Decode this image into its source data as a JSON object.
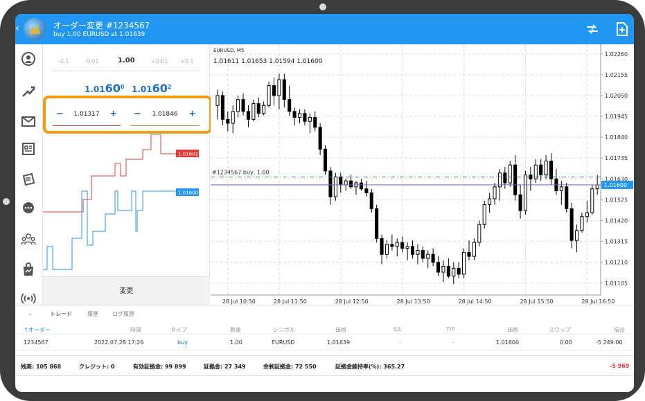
{
  "header": {
    "title": "オーダー変更 #1234567",
    "subtitle": "buy 1.00 EURUSD at 1.01639"
  },
  "volume": {
    "options": [
      "-0.1",
      "-0.01",
      "1.00",
      "+0.01",
      "+0.1"
    ],
    "selected": "1.00"
  },
  "quotes": {
    "bid": {
      "prefix": "1.01",
      "big": "60",
      "sup": "0"
    },
    "ask": {
      "prefix": "1.01",
      "big": "60",
      "sup": "2"
    }
  },
  "stop_loss": {
    "minus": "−",
    "plus": "+",
    "value": "1.01317"
  },
  "take_profit": {
    "minus": "−",
    "plus": "+",
    "value": "1.01846"
  },
  "depth_labels": {
    "ask": "1.01602",
    "bid": "1.01600"
  },
  "modify_label": "変更",
  "chart": {
    "symbol": "EURUSD, M5",
    "ohlc": "1.01611 1.01653 1.01594 1.01600",
    "order_label": "#1234567    buy, 1.00",
    "current_price": "1.01600",
    "y_labels": [
      "1.02260",
      "1.02155",
      "1.02050",
      "1.01945",
      "1.01840",
      "1.01735",
      "1.01630",
      "1.01525",
      "1.01420",
      "1.01315",
      "1.01210",
      "1.01105"
    ],
    "x_labels": [
      "28 Jul 10:50",
      "28 Jul 11:50",
      "28 Jul 12:50",
      "28 Jul 13:50",
      "28 Jul 14:50",
      "28 Jul 15:50",
      "28 Jul 16:50"
    ]
  },
  "chart_data": {
    "type": "candlestick",
    "symbol": "EURUSD",
    "timeframe": "M5",
    "ylim": [
      1.0105,
      1.0231
    ],
    "open_order_price": 1.01639,
    "current_price": 1.016,
    "candles": [
      [
        1.02,
        1.0208,
        1.0193,
        1.0205
      ],
      [
        1.0205,
        1.0207,
        1.019,
        1.0193
      ],
      [
        1.0193,
        1.0197,
        1.0187,
        1.0191
      ],
      [
        1.0191,
        1.02,
        1.0186,
        1.0197
      ],
      [
        1.0197,
        1.0205,
        1.0194,
        1.0203
      ],
      [
        1.0203,
        1.0206,
        1.0195,
        1.0197
      ],
      [
        1.0197,
        1.02,
        1.0189,
        1.0193
      ],
      [
        1.0193,
        1.0203,
        1.0192,
        1.0201
      ],
      [
        1.0201,
        1.0204,
        1.0194,
        1.0196
      ],
      [
        1.0196,
        1.0202,
        1.0195,
        1.02
      ],
      [
        1.02,
        1.0212,
        1.0199,
        1.021
      ],
      [
        1.021,
        1.0214,
        1.02,
        1.0205
      ],
      [
        1.0205,
        1.0216,
        1.0198,
        1.0213
      ],
      [
        1.0213,
        1.0216,
        1.0199,
        1.0203
      ],
      [
        1.0203,
        1.021,
        1.0195,
        1.0197
      ],
      [
        1.0197,
        1.0199,
        1.019,
        1.0194
      ],
      [
        1.0194,
        1.0198,
        1.0191,
        1.0196
      ],
      [
        1.0196,
        1.0198,
        1.019,
        1.0192
      ],
      [
        1.0192,
        1.0196,
        1.0186,
        1.0194
      ],
      [
        1.0194,
        1.0197,
        1.0187,
        1.0189
      ],
      [
        1.0189,
        1.0191,
        1.0175,
        1.0178
      ],
      [
        1.0178,
        1.018,
        1.0165,
        1.0167
      ],
      [
        1.0167,
        1.0169,
        1.015,
        1.0154
      ],
      [
        1.0154,
        1.0166,
        1.0152,
        1.0164
      ],
      [
        1.0164,
        1.0166,
        1.0156,
        1.016
      ],
      [
        1.016,
        1.0163,
        1.0157,
        1.0162
      ],
      [
        1.0162,
        1.0165,
        1.0158,
        1.0159
      ],
      [
        1.0159,
        1.0162,
        1.0155,
        1.0161
      ],
      [
        1.0161,
        1.0163,
        1.0157,
        1.0158
      ],
      [
        1.0158,
        1.0162,
        1.0154,
        1.0156
      ],
      [
        1.0156,
        1.0158,
        1.0146,
        1.0148
      ],
      [
        1.0148,
        1.015,
        1.0131,
        1.0133
      ],
      [
        1.0133,
        1.0135,
        1.012,
        1.0125
      ],
      [
        1.0125,
        1.0132,
        1.0123,
        1.013
      ],
      [
        1.013,
        1.0135,
        1.0127,
        1.0129
      ],
      [
        1.0129,
        1.0133,
        1.0124,
        1.0131
      ],
      [
        1.0131,
        1.0134,
        1.0126,
        1.0128
      ],
      [
        1.0128,
        1.0131,
        1.0122,
        1.0129
      ],
      [
        1.0129,
        1.0132,
        1.0123,
        1.0125
      ],
      [
        1.0125,
        1.013,
        1.012,
        1.0127
      ],
      [
        1.0127,
        1.0129,
        1.0121,
        1.0123
      ],
      [
        1.0123,
        1.0127,
        1.0118,
        1.0125
      ],
      [
        1.0125,
        1.0128,
        1.0119,
        1.0121
      ],
      [
        1.0121,
        1.0124,
        1.0114,
        1.0116
      ],
      [
        1.0116,
        1.0122,
        1.0111,
        1.0119
      ],
      [
        1.0119,
        1.0123,
        1.0113,
        1.0114
      ],
      [
        1.0114,
        1.0121,
        1.011,
        1.0118
      ],
      [
        1.0118,
        1.0121,
        1.0113,
        1.0115
      ],
      [
        1.0115,
        1.0128,
        1.0113,
        1.0126
      ],
      [
        1.0126,
        1.0132,
        1.0122,
        1.0124
      ],
      [
        1.0124,
        1.0133,
        1.0122,
        1.0131
      ],
      [
        1.0131,
        1.0142,
        1.0129,
        1.014
      ],
      [
        1.014,
        1.0152,
        1.0138,
        1.015
      ],
      [
        1.015,
        1.0156,
        1.0146,
        1.0153
      ],
      [
        1.0153,
        1.0161,
        1.015,
        1.0159
      ],
      [
        1.0159,
        1.0168,
        1.0152,
        1.0166
      ],
      [
        1.0166,
        1.0169,
        1.0158,
        1.0161
      ],
      [
        1.0161,
        1.0172,
        1.0159,
        1.017
      ],
      [
        1.017,
        1.0175,
        1.0152,
        1.0155
      ],
      [
        1.0155,
        1.016,
        1.0143,
        1.0147
      ],
      [
        1.0147,
        1.0167,
        1.0145,
        1.0165
      ],
      [
        1.0165,
        1.0169,
        1.0157,
        1.0163
      ],
      [
        1.0163,
        1.0173,
        1.0161,
        1.017
      ],
      [
        1.017,
        1.0173,
        1.0162,
        1.0165
      ],
      [
        1.0165,
        1.0175,
        1.0163,
        1.0172
      ],
      [
        1.0172,
        1.0176,
        1.016,
        1.0163
      ],
      [
        1.0163,
        1.0168,
        1.0155,
        1.0157
      ],
      [
        1.0157,
        1.0162,
        1.015,
        1.0159
      ],
      [
        1.0159,
        1.0161,
        1.0146,
        1.0148
      ],
      [
        1.0148,
        1.0151,
        1.0128,
        1.0132
      ],
      [
        1.0132,
        1.014,
        1.0126,
        1.0137
      ],
      [
        1.0137,
        1.0146,
        1.0136,
        1.0144
      ],
      [
        1.0144,
        1.0152,
        1.0141,
        1.0146
      ],
      [
        1.0146,
        1.016,
        1.0145,
        1.0158
      ],
      [
        1.0158,
        1.0165,
        1.0155,
        1.016
      ]
    ]
  },
  "bottom": {
    "tabs": [
      "トレード",
      "履歴",
      "ログ履歴"
    ],
    "active_tab": "トレード",
    "headers": {
      "order": "↑オーダー",
      "time": "時間",
      "type": "タイプ",
      "volume": "数量",
      "symbol": "シンボル",
      "price": "価格",
      "sl": "S/L",
      "tp": "T/P",
      "cur_price": "価格",
      "swap": "スワップ",
      "profit": "損益"
    },
    "row": {
      "order": "1234567",
      "time": "2022.07.28 17:26",
      "type": "buy",
      "volume": "1.00",
      "symbol": "EURUSD",
      "price": "1.01639",
      "sl": "–",
      "tp": "–",
      "cur_price": "1.01600",
      "swap": "0.00",
      "profit": "-5 249.00"
    },
    "summary": {
      "balance": "残高:  105 868",
      "credit": "クレジット:  0",
      "equity": "有効証拠金:  99 899",
      "margin": "証拠金:  27 349",
      "free_margin": "余剰証拠金:  72 550",
      "margin_level": "証拠金維持率(%):  365.27",
      "total": "-5 969"
    },
    "colors": {
      "buy": "#1e6fd0",
      "loss": "#e53935"
    }
  },
  "colors": {
    "accent": "#2196f3",
    "highlight": "#f39c12",
    "ask_line": "#e53935",
    "bid_line": "#2196f3",
    "order_line": "#2e9e3f"
  }
}
